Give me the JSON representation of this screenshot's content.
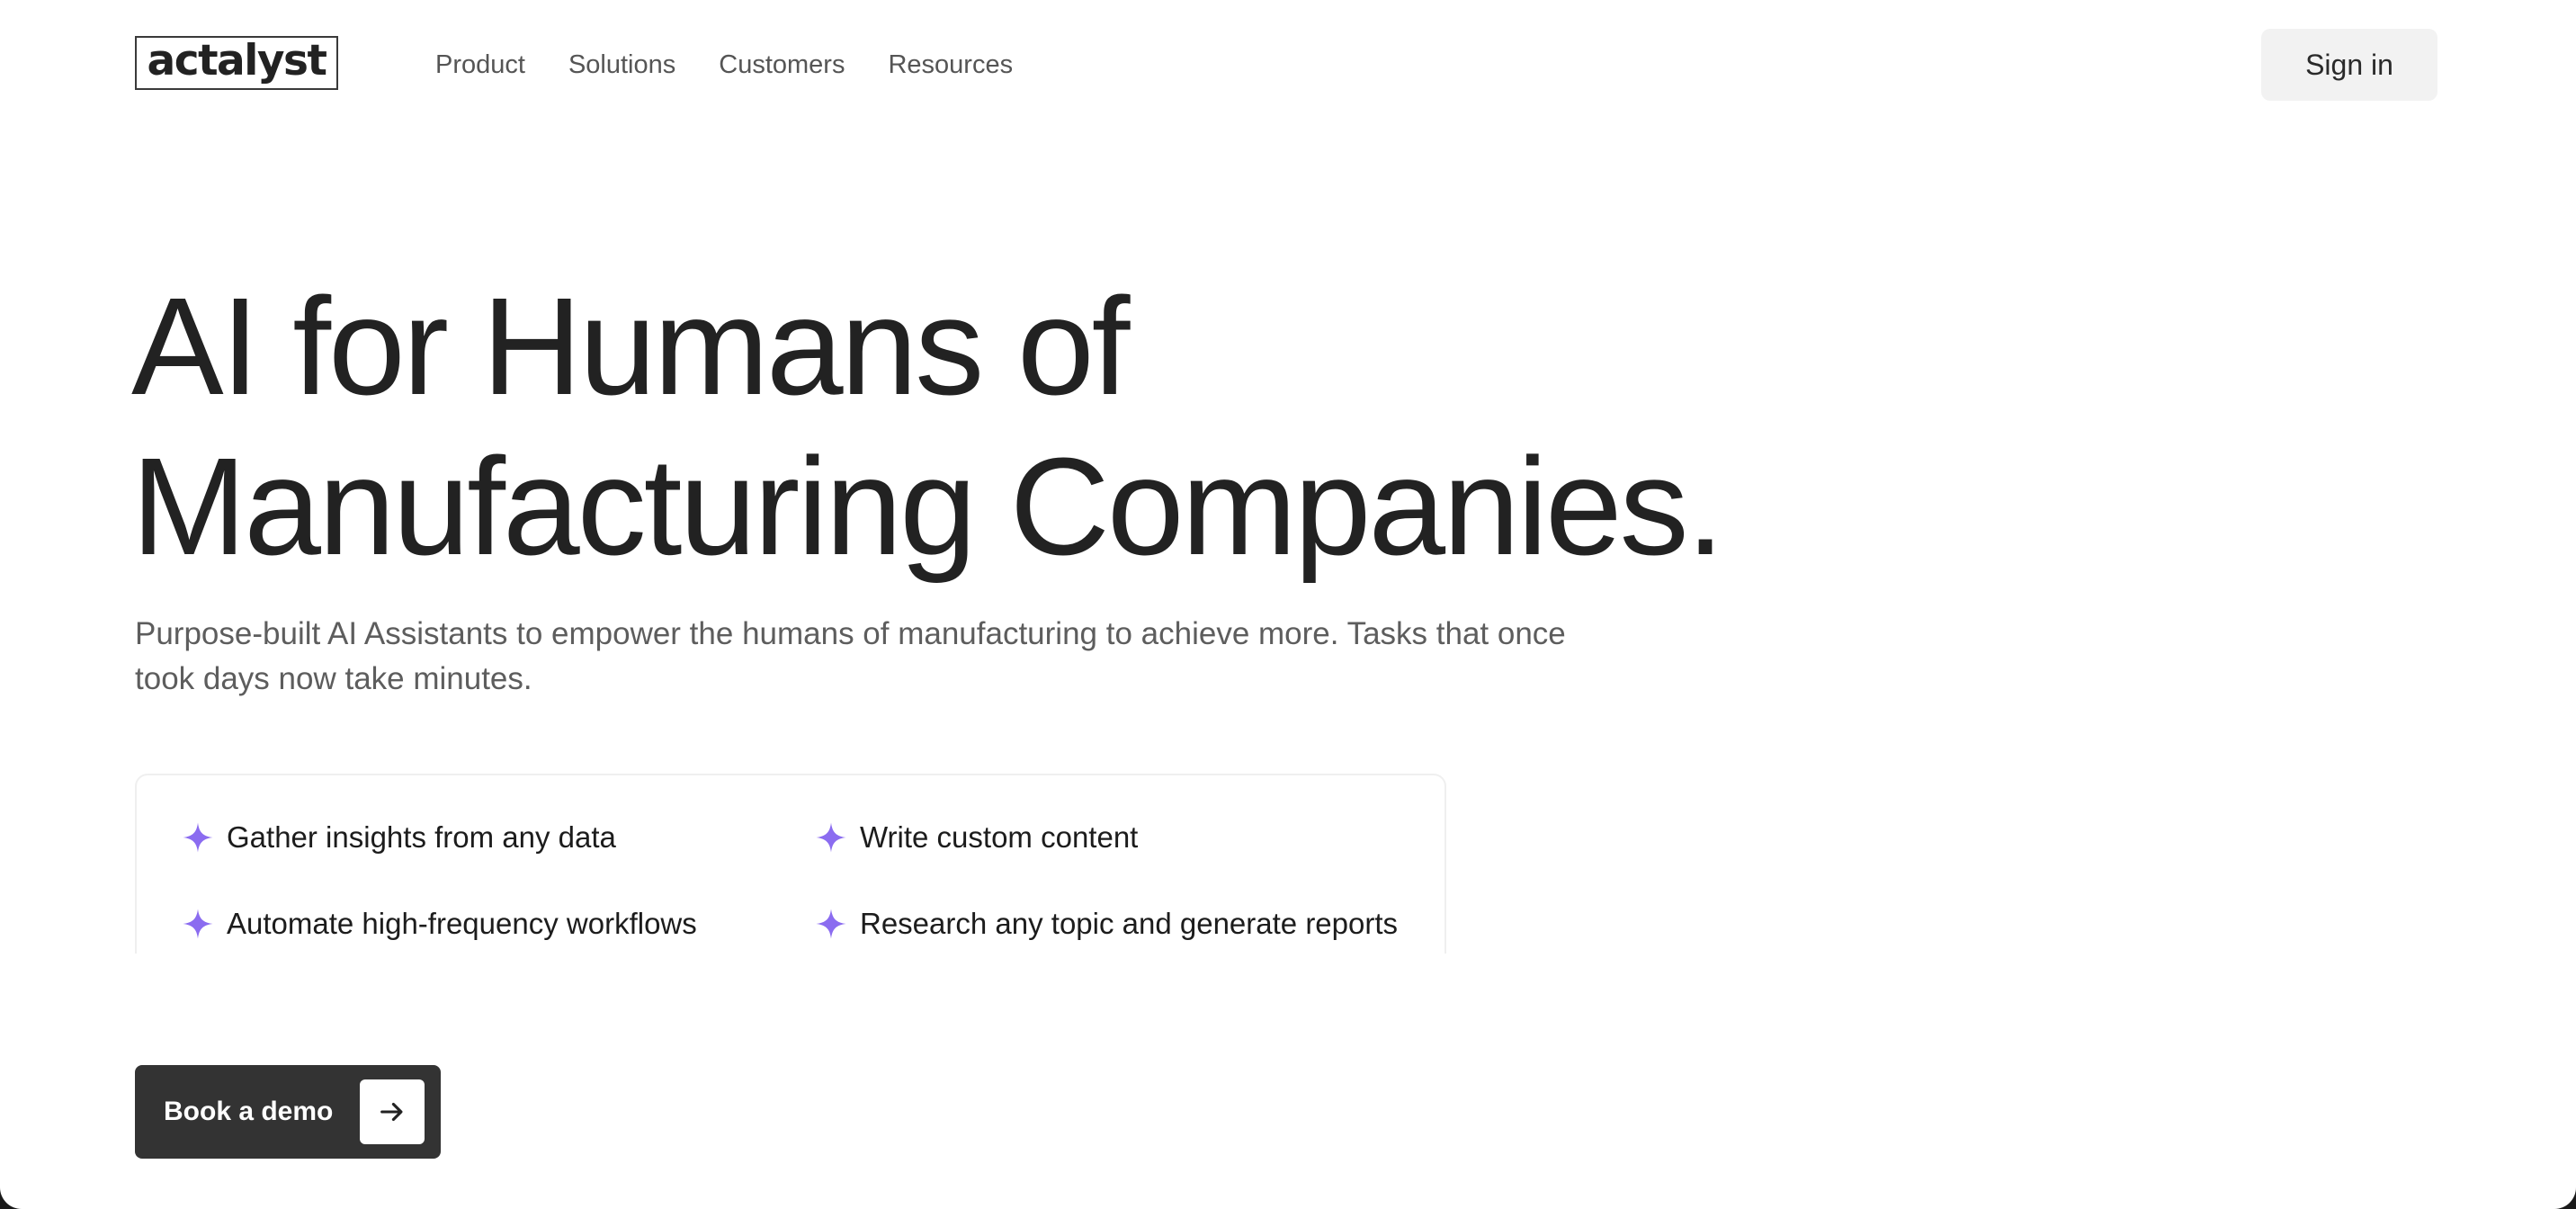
{
  "brand": {
    "logo_text": "actalyst"
  },
  "nav": {
    "items": [
      {
        "label": "Product"
      },
      {
        "label": "Solutions"
      },
      {
        "label": "Customers"
      },
      {
        "label": "Resources"
      }
    ]
  },
  "header": {
    "signin_label": "Sign in"
  },
  "hero": {
    "title_line1": "AI for Humans of",
    "title_line2": "Manufacturing Companies.",
    "subtitle": "Purpose-built AI Assistants to empower the humans of manufacturing to achieve more. Tasks that once took days now take minutes."
  },
  "features": {
    "icon": "sparkle-icon",
    "items": [
      {
        "label": "Gather insights from any data"
      },
      {
        "label": "Write custom content"
      },
      {
        "label": "Automate high-frequency workflows"
      },
      {
        "label": "Research any topic and generate reports"
      }
    ]
  },
  "cta": {
    "label": "Book a demo",
    "icon": "arrow-right-icon"
  },
  "colors": {
    "accent_sparkle": "#8b6cf0",
    "cta_background": "#333333",
    "signin_background": "#f2f2f2",
    "text_primary": "#222222",
    "text_secondary": "#5d5d5d"
  }
}
